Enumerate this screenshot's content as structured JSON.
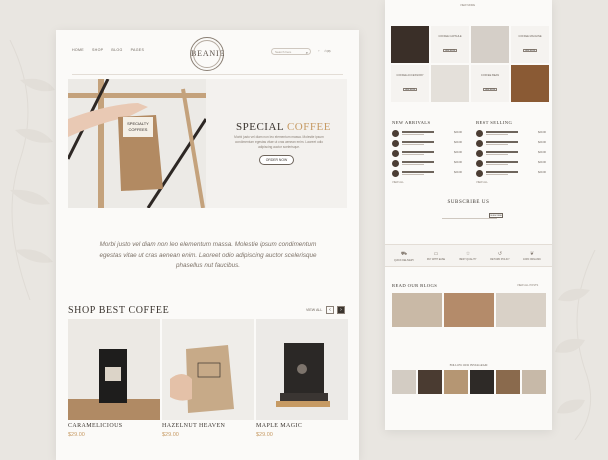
{
  "left": {
    "nav": [
      "HOME",
      "SHOP",
      "BLOG",
      "PAGES"
    ],
    "logo_text": "BEANIE",
    "search_placeholder": "Search here",
    "cart_count": "(0)",
    "hero": {
      "title_part1": "SPECIAL",
      "title_part2": "COFFEE",
      "text": "Morbi justo vel diam non leo elementum massa. Molestie ipsum condimentum egestas vitae ut cras aenean enim. Laoreet odio adipiscing auctor scelerisque.",
      "button": "ORDER NOW",
      "bag_label": "SPECIALTY COFFEES"
    },
    "quote": "Morbi justo vel diam non leo elementum massa. Molestie ipsum condimentum egestas vitae ut cras aenean enim. Laoreet odio adipiscing auctor scelerisque phasellus nut faucibus.",
    "shop": {
      "title": "SHOP BEST COFFEE",
      "view_all": "VIEW ALL",
      "products": [
        {
          "name": "CARAMELICIOUS",
          "price": "$29.00"
        },
        {
          "name": "HAZELNUT HEAVEN",
          "price": "$29.00"
        },
        {
          "name": "MAPLE MAGIC",
          "price": "$29.00"
        }
      ]
    }
  },
  "right": {
    "top_link": "VIEW MORE",
    "categories": [
      {
        "title": "COFFEE CAPSULE",
        "button": "VIEW MORE"
      },
      {
        "title": "COFFEE MACHINE",
        "button": "VIEW MORE"
      },
      {
        "title": "COFFEE ACCESSORY",
        "button": "VIEW MORE"
      },
      {
        "title": "COFFEE BEAN",
        "button": "VIEW MORE"
      }
    ],
    "new_arrivals": {
      "title": "NEW ARRIVALS",
      "items": [
        "$29.00",
        "$29.00",
        "$29.00",
        "$29.00",
        "$29.00",
        "$29.00"
      ],
      "view_all": "VIEW ALL"
    },
    "best_selling": {
      "title": "BEST SELLING",
      "items": [
        "$29.00",
        "$29.00",
        "$29.00",
        "$29.00",
        "$29.00",
        "$29.00"
      ],
      "view_all": "VIEW ALL"
    },
    "subscribe": {
      "title": "SUBSCRIBE US",
      "button": "SUBSCRIBE"
    },
    "features": [
      "QUICK DELIVERY",
      "PAY WITH EASE",
      "BEST QUALITY",
      "RETURN POLICY",
      "100% ORGANIC"
    ],
    "blogs": {
      "title": "READ OUR BLOGS",
      "view_all": "VIEW ALL POSTS"
    },
    "instagram": "FOLLOW OUR INSTAGRAM",
    "colors": {
      "accent": "#c69a63",
      "text": "#3a342e"
    }
  }
}
